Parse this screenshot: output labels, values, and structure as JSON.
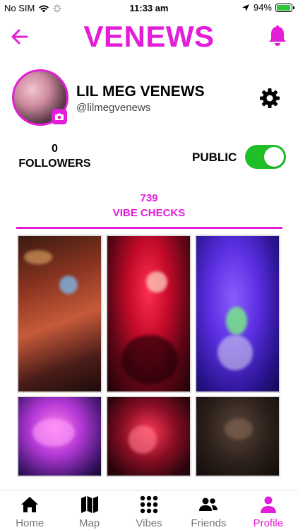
{
  "status_bar": {
    "carrier": "No SIM",
    "time": "11:33 am",
    "battery": "94%",
    "battery_level": 0.94
  },
  "header": {
    "title": "VENEWS",
    "back_icon": "arrow-left-icon",
    "bell_icon": "bell-icon"
  },
  "profile": {
    "name": "LIL MEG VENEWS",
    "handle": "@lilmegvenews",
    "avatar_badge_icon": "camera-icon",
    "settings_icon": "gear-icon"
  },
  "followers": {
    "count": "0",
    "label": "FOLLOWERS"
  },
  "visibility": {
    "label": "PUBLIC",
    "enabled": true
  },
  "vibe_checks": {
    "count": "739",
    "label": "VIBE CHECKS"
  },
  "grid": {
    "tiles": [
      "club-stairway",
      "red-dance-floor",
      "purple-stage-dancer",
      "purple-lights-crowd",
      "red-stage-band",
      "dark-bar-room"
    ]
  },
  "tabs": [
    {
      "label": "Home",
      "icon": "home-icon",
      "active": false
    },
    {
      "label": "Map",
      "icon": "map-icon",
      "active": false
    },
    {
      "label": "Vibes",
      "icon": "dots-grid-icon",
      "active": false
    },
    {
      "label": "Friends",
      "icon": "friends-icon",
      "active": false
    },
    {
      "label": "Profile",
      "icon": "person-icon",
      "active": true
    }
  ],
  "colors": {
    "accent": "#e21ed8",
    "toggle_on": "#1fbf28",
    "inactive_tab": "#777777"
  }
}
